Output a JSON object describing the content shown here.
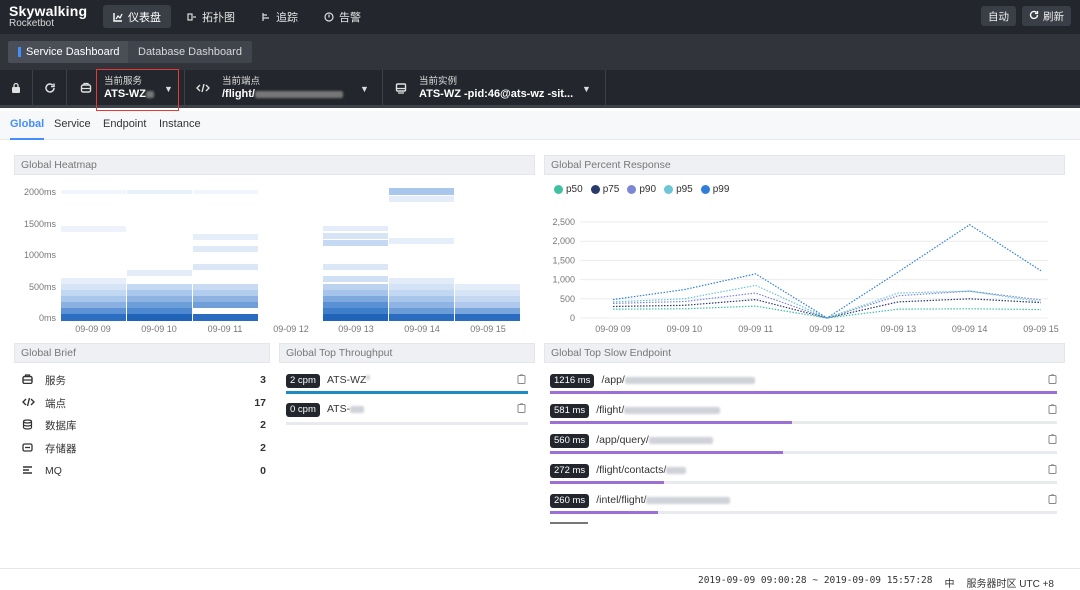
{
  "app": {
    "name": "Skywalking",
    "subtitle": "Rocketbot"
  },
  "nav": [
    {
      "label": "仪表盘",
      "icon": "dashboard-icon"
    },
    {
      "label": "拓扑图",
      "icon": "topology-icon"
    },
    {
      "label": "追踪",
      "icon": "trace-icon"
    },
    {
      "label": "告警",
      "icon": "alarm-icon"
    }
  ],
  "top_buttons": {
    "auto": "自动",
    "refresh": "刷新"
  },
  "dashboards": {
    "active": "Service Dashboard",
    "inactive": "Database Dashboard"
  },
  "selectors": {
    "service": {
      "label": "当前服务",
      "value": "ATS-WZ"
    },
    "endpoint": {
      "label": "当前端点",
      "value": "/flight/"
    },
    "instance": {
      "label": "当前实例",
      "value": "ATS-WZ -pid:46@ats-wz -sit..."
    }
  },
  "subtabs": [
    "Global",
    "Service",
    "Endpoint",
    "Instance"
  ],
  "heatmap": {
    "title": "Global Heatmap",
    "y_ticks": [
      "2000ms",
      "1500ms",
      "1000ms",
      "500ms",
      "0ms"
    ],
    "x_ticks": [
      "09-09 09",
      "09-09 10",
      "09-09 11",
      "09-09 12",
      "09-09 13",
      "09-09 14",
      "09-09 15"
    ]
  },
  "percent": {
    "title": "Global Percent Response",
    "legend": [
      {
        "name": "p50",
        "color": "#3fc1a0"
      },
      {
        "name": "p75",
        "color": "#283a6a"
      },
      {
        "name": "p90",
        "color": "#7c86d6"
      },
      {
        "name": "p95",
        "color": "#6cc6d8"
      },
      {
        "name": "p99",
        "color": "#2f7fd8"
      }
    ]
  },
  "chart_data": {
    "type": "line",
    "x": [
      "09-09 09",
      "09-09 10",
      "09-09 11",
      "09-09 12",
      "09-09 13",
      "09-09 14",
      "09-09 15"
    ],
    "ylim": [
      0,
      2500
    ],
    "y_ticks": [
      "2,500",
      "2,000",
      "1,500",
      "1,000",
      "500",
      "0"
    ],
    "series": [
      {
        "name": "p50",
        "values": [
          230,
          240,
          310,
          0,
          230,
          240,
          220
        ]
      },
      {
        "name": "p75",
        "values": [
          300,
          330,
          480,
          0,
          420,
          500,
          400
        ]
      },
      {
        "name": "p90",
        "values": [
          380,
          430,
          650,
          0,
          580,
          700,
          470
        ]
      },
      {
        "name": "p95",
        "values": [
          420,
          500,
          850,
          0,
          650,
          700,
          420
        ]
      },
      {
        "name": "p99",
        "values": [
          480,
          740,
          1150,
          0,
          1200,
          2430,
          1230
        ]
      }
    ]
  },
  "brief": {
    "title": "Global Brief",
    "items": [
      {
        "label": "服务",
        "value": "3",
        "icon": "service-icon"
      },
      {
        "label": "端点",
        "value": "17",
        "icon": "endpoint-icon"
      },
      {
        "label": "数据库",
        "value": "2",
        "icon": "database-icon"
      },
      {
        "label": "存储器",
        "value": "2",
        "icon": "storage-icon"
      },
      {
        "label": "MQ",
        "value": "0",
        "icon": "mq-icon"
      }
    ]
  },
  "throughput": {
    "title": "Global Top Throughput",
    "items": [
      {
        "value": "2 cpm",
        "name": "ATS-WZ",
        "fill": 1.0,
        "color": "#1e8bc3"
      },
      {
        "value": "0 cpm",
        "name": "ATS-",
        "fill": 0.0,
        "color": "#1e8bc3"
      }
    ]
  },
  "slow": {
    "title": "Global Top Slow Endpoint",
    "items": [
      {
        "value": "1216 ms",
        "name": "/app/",
        "fill": 1.0
      },
      {
        "value": "581 ms",
        "name": "/flight/",
        "fill": 0.478
      },
      {
        "value": "560 ms",
        "name": "/app/query/",
        "fill": 0.46
      },
      {
        "value": "272 ms",
        "name": "/flight/contacts/",
        "fill": 0.224
      },
      {
        "value": "260 ms",
        "name": "/intel/flight/",
        "fill": 0.214
      }
    ],
    "bar_color": "#9b6fd6"
  },
  "footer": {
    "range": "2019-09-09 09:00:28 ~ 2019-09-09 15:57:28",
    "lang": "中",
    "tz": "服务器时区 UTC +8"
  }
}
